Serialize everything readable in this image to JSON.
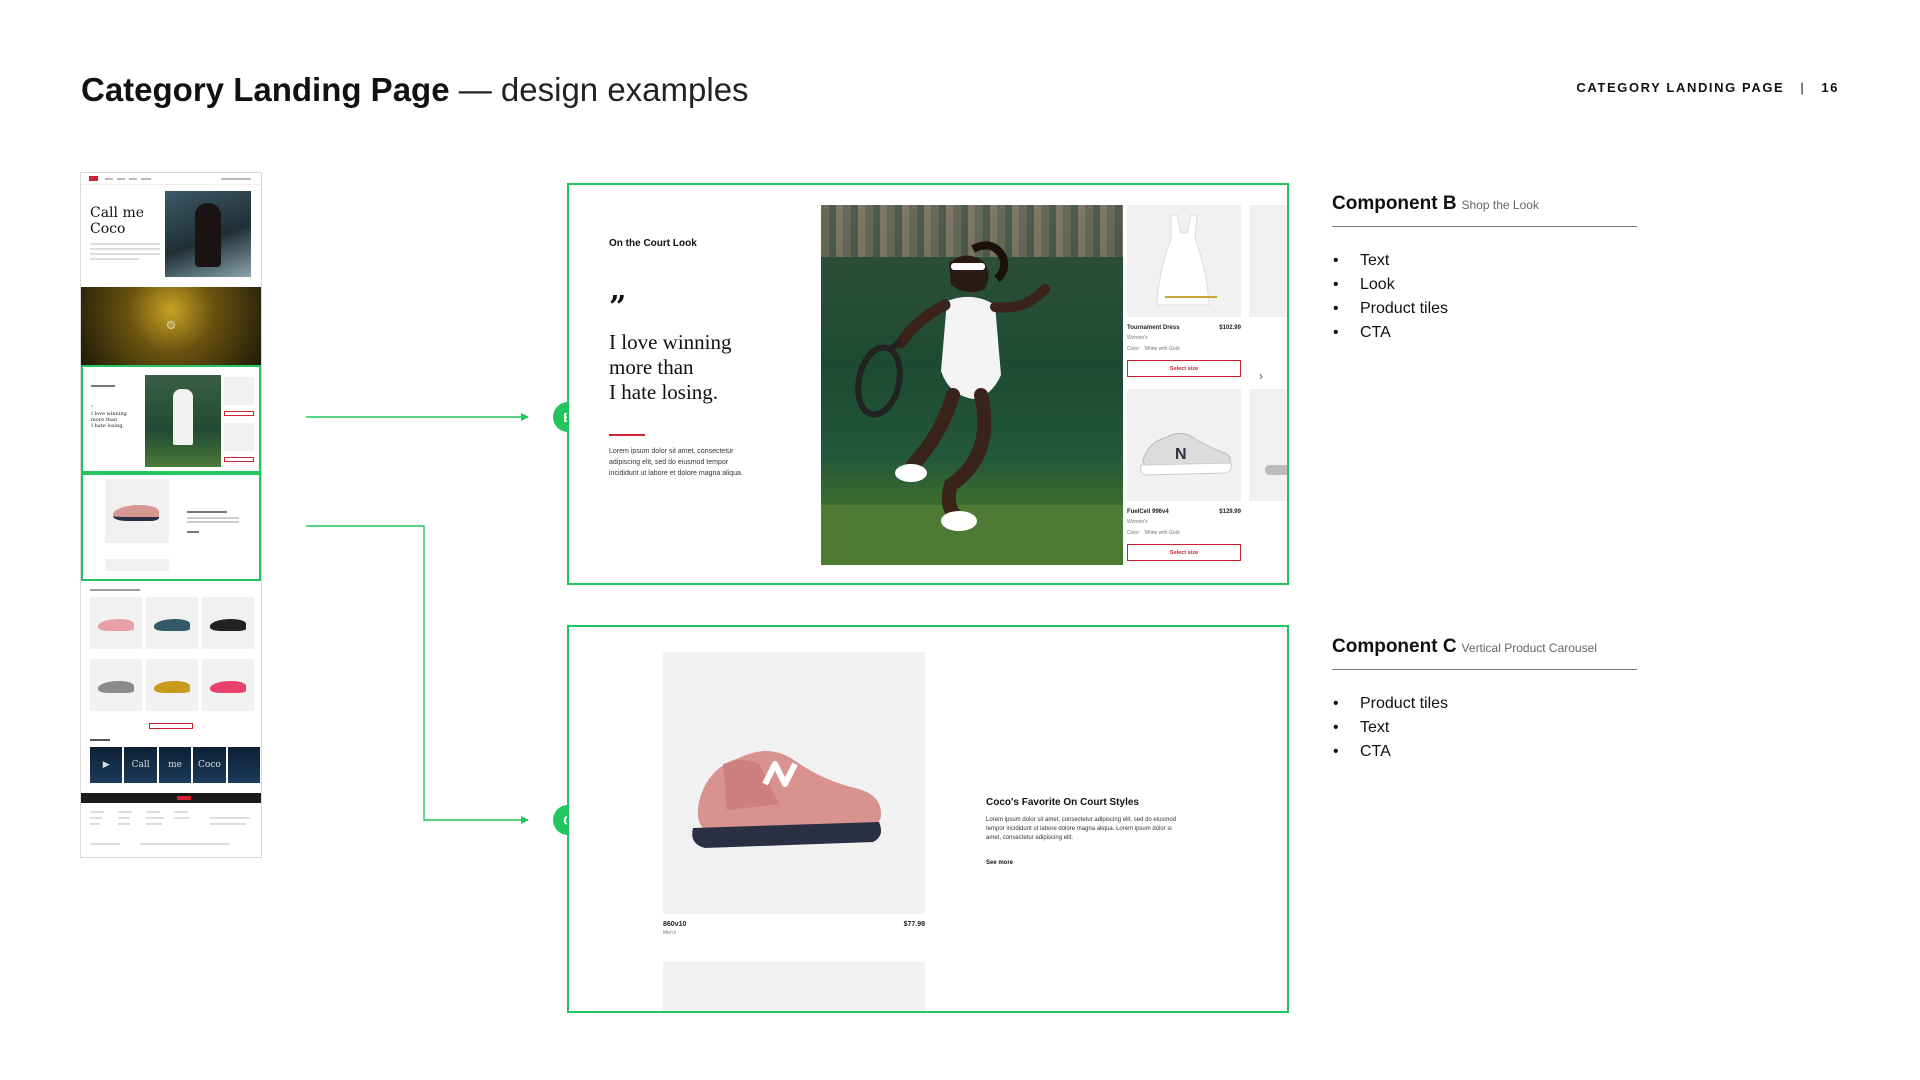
{
  "header": {
    "title_bold": "Category Landing Page",
    "title_light": "— design examples",
    "section_label": "CATEGORY LANDING PAGE",
    "separator": "|",
    "page_number": "16"
  },
  "thumbnail": {
    "hero_title": "Call me Coco",
    "video_labels": [
      "Call",
      "me",
      "Coco"
    ]
  },
  "markers": {
    "b": "B",
    "c": "C"
  },
  "component_b": {
    "heading": "On the Court Look",
    "quote_mark": "”",
    "quote_lines": [
      "I love winning",
      "more than",
      "I hate losing."
    ],
    "body": "Lorem ipsum dolor sit amet, consectetur adipiscing elit, sed do eiusmod tempor incididunt ut labore et dolore magna aliqua.",
    "products": [
      {
        "name": "Tournament Dress",
        "price": "$102.99",
        "gender": "Women's",
        "color_label": "Color:",
        "color_value": "White with Gold",
        "cta": "Select size"
      },
      {
        "name": "FuelCell 996v4",
        "price": "$129.99",
        "gender": "Women's",
        "color_label": "Color:",
        "color_value": "White with Gold",
        "cta": "Select size"
      }
    ],
    "next_icon": "chevron-right-icon"
  },
  "component_c": {
    "product": {
      "name": "860v10",
      "gender": "Men's",
      "price": "$77.99"
    },
    "title": "Coco's Favorite On Court Styles",
    "body": "Lorem ipsum dolor sit amet, consectetur adipiscing elit, sed do eiusmod tempor incididunt ut labore dolore magna aliqua. Lorem ipsum dolor si amet, consectetur adipiscing elit.",
    "link": "See more"
  },
  "descriptions": {
    "b": {
      "name": "Component B",
      "subtitle": "Shop the Look",
      "items": [
        "Text",
        "Look",
        "Product tiles",
        "CTA"
      ]
    },
    "c": {
      "name": "Component C",
      "subtitle": "Vertical Product Carousel",
      "items": [
        "Product tiles",
        "Text",
        "CTA"
      ]
    }
  },
  "colors": {
    "highlight": "#22c55e",
    "brand_red": "#d1202f",
    "tile_bg": "#f1f1f1",
    "text": "#111111"
  }
}
